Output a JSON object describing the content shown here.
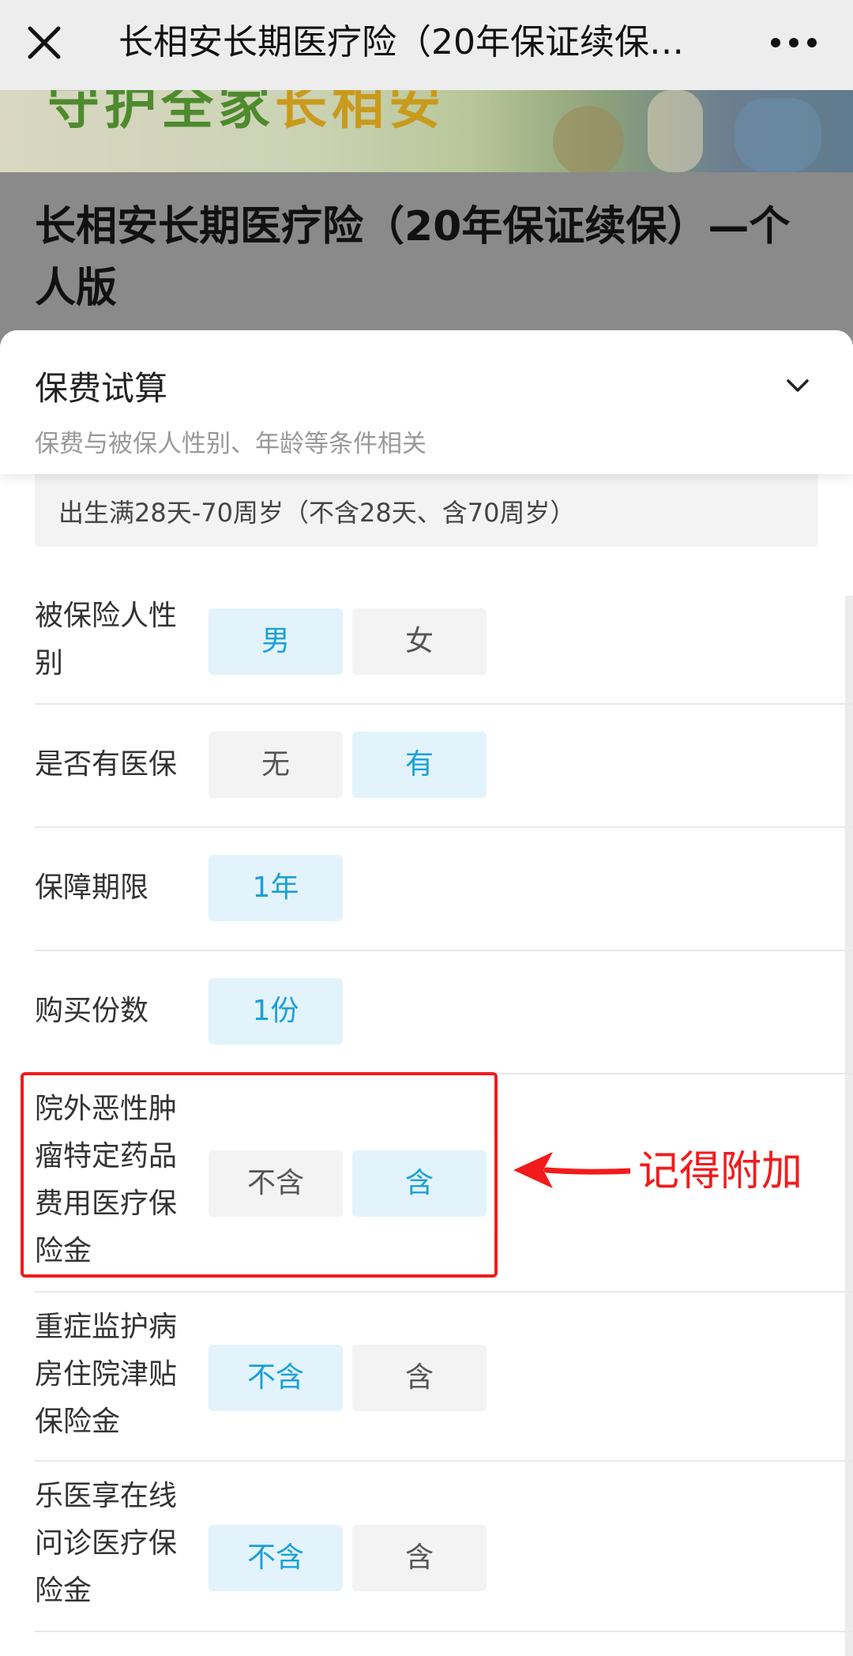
{
  "nav": {
    "title": "长相安长期医疗险（20年保证续保…",
    "close_icon": "close-icon",
    "more_icon": "more-dots-icon"
  },
  "banner": {
    "slogan_main": "守护全家",
    "slogan_highlight": "长相安"
  },
  "product": {
    "name": "长相安长期医疗险（20年保证续保）—个人版"
  },
  "calculator": {
    "title": "保费试算",
    "subtitle": "保费与被保人性别、年龄等条件相关",
    "collapse_icon": "chevron-down-icon",
    "age_range": "出生满28天-70周岁（不含28天、含70周岁）",
    "rows": [
      {
        "label": "被保险人性别",
        "options": [
          {
            "text": "男",
            "selected": true
          },
          {
            "text": "女",
            "selected": false
          }
        ]
      },
      {
        "label": "是否有医保",
        "options": [
          {
            "text": "无",
            "selected": false
          },
          {
            "text": "有",
            "selected": true
          }
        ]
      },
      {
        "label": "保障期限",
        "options": [
          {
            "text": "1年",
            "selected": true
          }
        ]
      },
      {
        "label": "购买份数",
        "options": [
          {
            "text": "1份",
            "selected": true
          }
        ]
      },
      {
        "label": "院外恶性肿瘤特定药品费用医疗保险金",
        "options": [
          {
            "text": "不含",
            "selected": false
          },
          {
            "text": "含",
            "selected": true
          }
        ]
      },
      {
        "label": "重症监护病房住院津贴保险金",
        "options": [
          {
            "text": "不含",
            "selected": true
          },
          {
            "text": "含",
            "selected": false
          }
        ]
      },
      {
        "label": "乐医享在线问诊医疗保险金",
        "options": [
          {
            "text": "不含",
            "selected": true
          },
          {
            "text": "含",
            "selected": false
          }
        ]
      }
    ]
  },
  "annotation": {
    "text": "记得附加",
    "color": "#f21b1b"
  },
  "colors": {
    "selected_text": "#1aa0d8",
    "selected_bg": "#e3f3fb",
    "unselected_bg": "#f3f3f3"
  }
}
